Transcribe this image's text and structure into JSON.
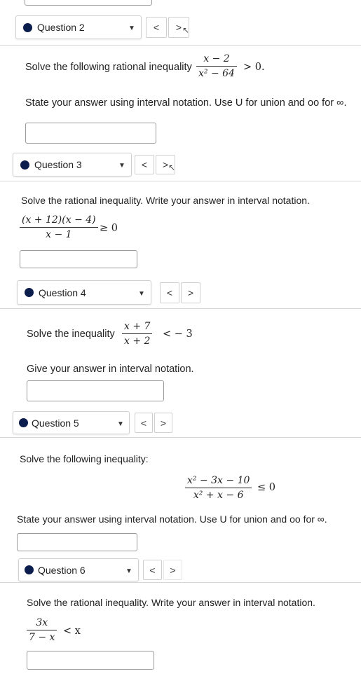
{
  "questions": [
    {
      "label": "Question 2",
      "prompt": "Solve the following rational inequality",
      "numerator": "x − 2",
      "denominator": "x² − 64",
      "relation": "> 0.",
      "instruction": "State your answer using interval notation. Use U for union and oo for ∞."
    },
    {
      "label": "Question 3",
      "prompt": "Solve the rational inequality. Write your answer in interval notation.",
      "numerator": "(x + 12)(x − 4)",
      "denominator": "x − 1",
      "relation": "≥ 0"
    },
    {
      "label": "Question 4",
      "prompt": "Solve the inequality",
      "numerator": "x + 7",
      "denominator": "x + 2",
      "relation": "< − 3",
      "instruction": "Give your answer in interval notation."
    },
    {
      "label": "Question 5",
      "prompt": "Solve the following inequality:",
      "numerator": "x² − 3x − 10",
      "denominator": "x² + x − 6",
      "relation": "≤ 0",
      "instruction": "State your answer using interval notation. Use U for union and oo for ∞."
    },
    {
      "label": "Question 6",
      "prompt": "Solve the rational inequality. Write your answer in interval notation.",
      "numerator": "3x",
      "denominator": "7 − x",
      "relation": "< x"
    }
  ],
  "nav": {
    "prev": "<",
    "next": ">",
    "dropdown": "▼"
  }
}
